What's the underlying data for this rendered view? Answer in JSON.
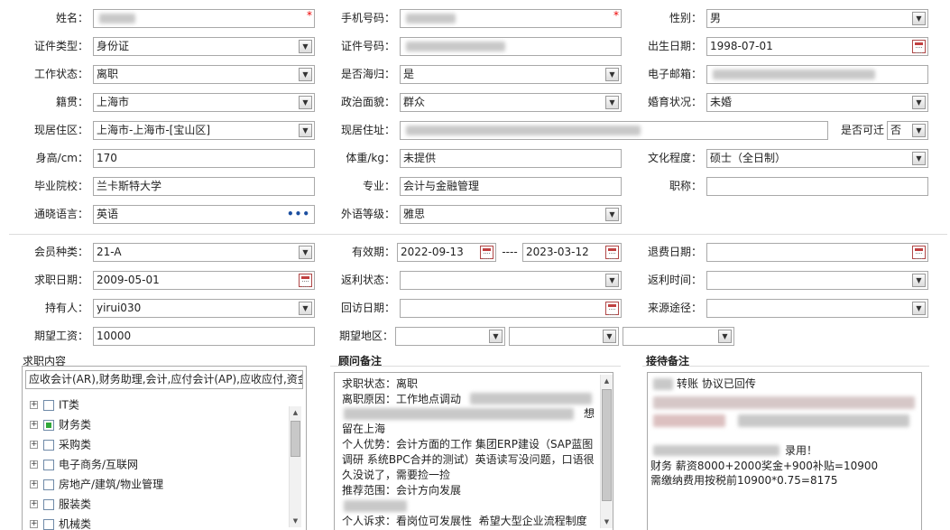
{
  "labels": {
    "name": "姓名：",
    "phone": "手机号码：",
    "gender": "性别：",
    "id_type": "证件类型：",
    "id_no": "证件号码：",
    "birth": "出生日期：",
    "work_status": "工作状态：",
    "overseas": "是否海归：",
    "email": "电子邮箱：",
    "origin": "籍贯：",
    "political": "政治面貌：",
    "marital": "婚育状况：",
    "residence_area": "现居住区：",
    "address": "现居住址：",
    "rentable": "是否可迁",
    "height": "身高/cm：",
    "weight": "体重/kg：",
    "education": "文化程度：",
    "school": "毕业院校：",
    "major": "专业：",
    "title": "职称：",
    "language": "通晓语言：",
    "lang_level": "外语等级：",
    "member_type": "会员种类：",
    "valid_period": "有效期：",
    "refund_date": "退费日期：",
    "job_date": "求职日期：",
    "rebate_status": "返利状态：",
    "rebate_time": "返利时间：",
    "holder": "持有人：",
    "visit_date": "回访日期：",
    "source": "来源途径：",
    "salary": "期望工资：",
    "region": "期望地区：",
    "range_sep": "----"
  },
  "values": {
    "gender": "男",
    "id_type": "身份证",
    "birth": "1998-07-01",
    "work_status": "离职",
    "overseas": "是",
    "origin": "上海市",
    "political": "群众",
    "marital": "未婚",
    "residence_area": "上海市-上海市-[宝山区]",
    "rentable": "否",
    "height": "170",
    "weight": "未提供",
    "education": "硕士（全日制）",
    "school": "兰卡斯特大学",
    "major": "会计与金融管理",
    "title": "",
    "language": "英语",
    "lang_level": "雅思",
    "member_type": "21-A",
    "valid_from": "2022-09-13",
    "valid_to": "2023-03-12",
    "refund_date": "",
    "job_date": "2009-05-01",
    "rebate_status": "",
    "rebate_time": "",
    "holder": "yirui030",
    "visit_date": "",
    "source": "",
    "salary": "10000"
  },
  "job_panel": {
    "title": "求职内容",
    "summary": "应收会计(AR),财务助理,会计,应付会计(AP),应收应付,资金",
    "tree": [
      {
        "label": "IT类",
        "checked": false
      },
      {
        "label": "财务类",
        "checked": true
      },
      {
        "label": "采购类",
        "checked": false
      },
      {
        "label": "电子商务/互联网",
        "checked": false
      },
      {
        "label": "房地产/建筑/物业管理",
        "checked": false
      },
      {
        "label": "服装类",
        "checked": false
      },
      {
        "label": "机械类",
        "checked": false
      }
    ]
  },
  "advisor_panel": {
    "title": "顾问备注",
    "lines": {
      "l1": "求职状态：离职",
      "l2": "离职原因：工作地点调动",
      "l2b": "想",
      "l3": "留在上海",
      "l4": "个人优势：会计方面的工作 集团ERP建设（SAP蓝图",
      "l5": "调研 系统BPC合并的测试）英语读写没问题，口语很",
      "l6": "久没说了，需要捡一捡",
      "l7": "推荐范围：会计方向发展",
      "l8": "个人诉求：看岗位可发展性  希望大型企业流程制度"
    }
  },
  "reception_panel": {
    "title": "接待备注",
    "lines": {
      "l1": "转账 协议已回传",
      "l2": "录用！",
      "l3": "财务 薪资8000+2000奖金+900补贴=10900",
      "l4": "需缴纳费用按税前10900*0.75=8175"
    }
  }
}
